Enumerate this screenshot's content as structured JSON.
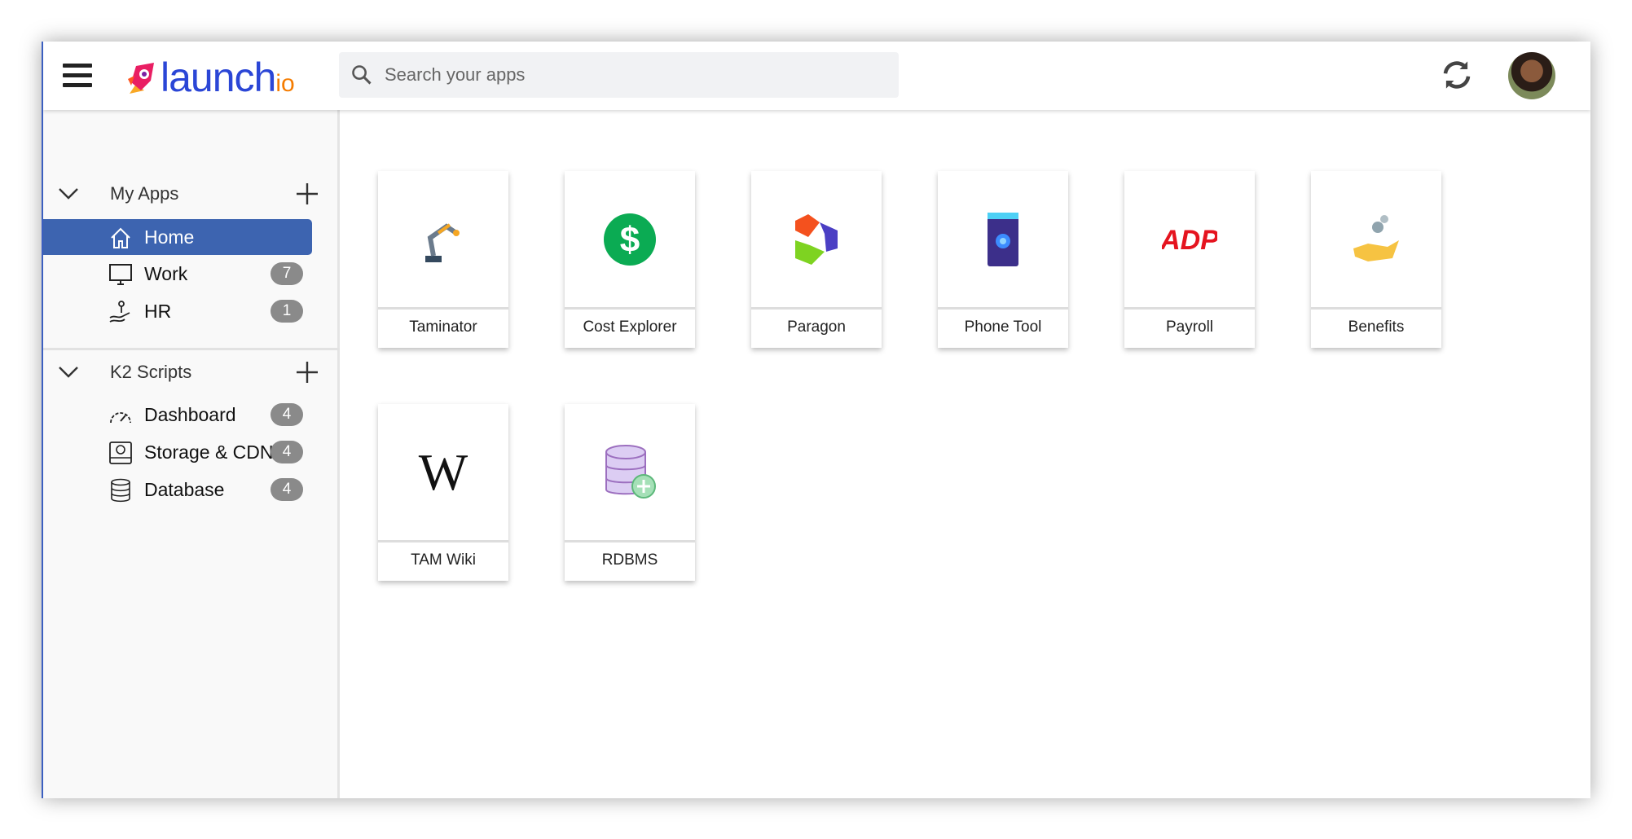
{
  "header": {
    "logo_word": "launch",
    "logo_suffix": "io",
    "search_placeholder": "Search your apps"
  },
  "sidebar": {
    "groups": [
      {
        "title": "My Apps",
        "items": [
          {
            "label": "Home",
            "active": true
          },
          {
            "label": "Work",
            "badge": "7"
          },
          {
            "label": "HR",
            "badge": "1"
          }
        ]
      },
      {
        "title": "K2 Scripts",
        "items": [
          {
            "label": "Dashboard",
            "badge": "4"
          },
          {
            "label": "Storage & CDN",
            "badge": "4"
          },
          {
            "label": "Database",
            "badge": "4"
          }
        ]
      }
    ]
  },
  "apps": [
    {
      "name": "Taminator"
    },
    {
      "name": "Cost Explorer"
    },
    {
      "name": "Paragon"
    },
    {
      "name": "Phone Tool"
    },
    {
      "name": "Payroll"
    },
    {
      "name": "Benefits"
    },
    {
      "name": "TAM Wiki"
    },
    {
      "name": "RDBMS"
    }
  ],
  "colors": {
    "accent": "#3d64b0",
    "badge": "#8a8a8a",
    "logo": "#2b46d6"
  }
}
